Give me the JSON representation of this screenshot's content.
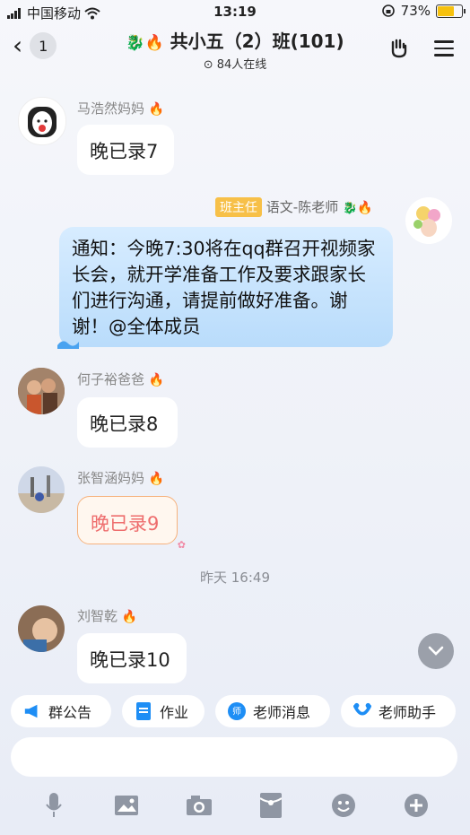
{
  "status": {
    "carrier": "中国移动",
    "time": "13:19",
    "battery": "73%"
  },
  "header": {
    "back_count": "1",
    "title": "共小五（2）班(101)",
    "online": "84人在线"
  },
  "messages": [
    {
      "sender": "马浩然妈妈",
      "text": "晚已录7"
    },
    {
      "sender": "何子裕爸爸",
      "text": "晚已录8"
    },
    {
      "sender": "张智涵妈妈",
      "text": "晚已录9"
    },
    {
      "sender": "刘智乾",
      "text": "晚已录10"
    }
  ],
  "notice": {
    "role_tag": "班主任",
    "sender": "语文-陈老师",
    "text": "通知：今晚7:30将在qq群召开视频家长会，就开学准备工作及要求跟家长们进行沟通，请提前做好准备。谢谢！@全体成员"
  },
  "time_separator": "昨天 16:49",
  "shortcuts": [
    {
      "label": "群公告",
      "icon": "megaphone-icon"
    },
    {
      "label": "作业",
      "icon": "document-icon"
    },
    {
      "label": "老师消息",
      "icon": "teacher-message-icon"
    },
    {
      "label": "老师助手",
      "icon": "assistant-icon"
    }
  ],
  "colors": {
    "notice_bg": "#c6e3fd",
    "role_tag": "#f7c048",
    "accent": "#1e8ef5"
  }
}
